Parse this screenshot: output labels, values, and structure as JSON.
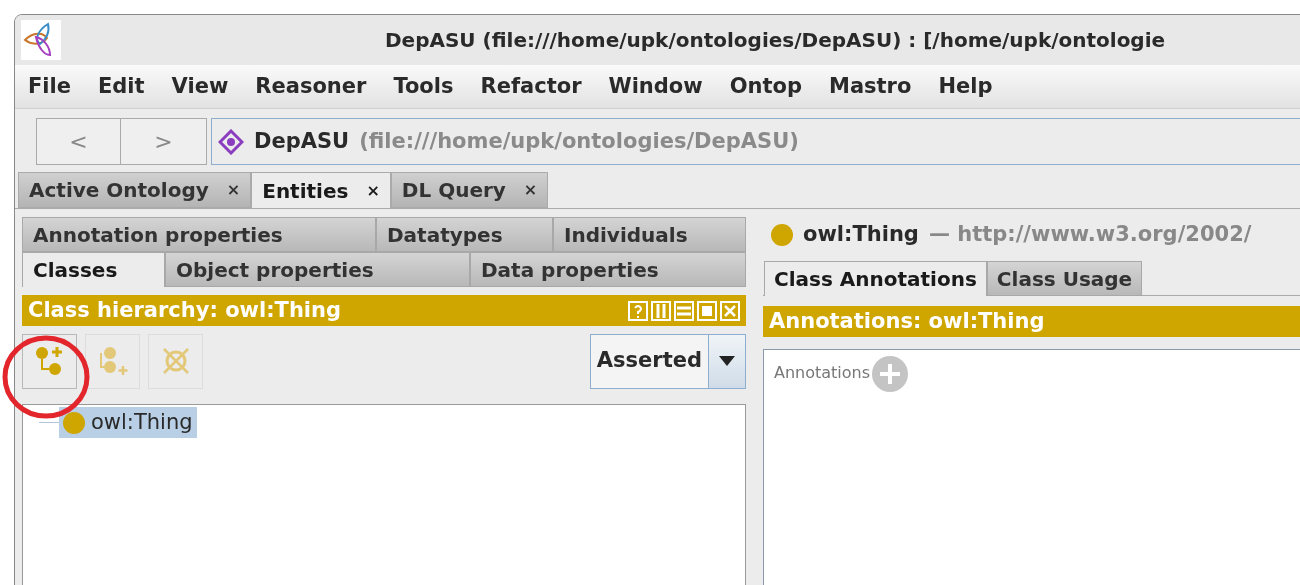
{
  "window": {
    "title": "DepASU (file:///home/upk/ontologies/DepASU) : [/home/upk/ontologie"
  },
  "menu": [
    "File",
    "Edit",
    "View",
    "Reasoner",
    "Tools",
    "Refactor",
    "Window",
    "Ontop",
    "Mastro",
    "Help"
  ],
  "nav": {
    "back": "<",
    "forward": ">",
    "ontology_name": "DepASU",
    "ontology_iri": "(file:///home/upk/ontologies/DepASU)"
  },
  "tabs": [
    {
      "label": "Active Ontology",
      "close": "×",
      "selected": false
    },
    {
      "label": "Entities",
      "close": "×",
      "selected": true
    },
    {
      "label": "DL Query",
      "close": "×",
      "selected": false
    }
  ],
  "left": {
    "entity_tab_rows": [
      [
        {
          "label": "Annotation properties",
          "selected": false
        },
        {
          "label": "Datatypes",
          "selected": false
        },
        {
          "label": "Individuals",
          "selected": false
        }
      ],
      [
        {
          "label": "Classes",
          "selected": true
        },
        {
          "label": "Object properties",
          "selected": false
        },
        {
          "label": "Data properties",
          "selected": false
        }
      ]
    ],
    "view_title": "Class hierarchy: owl:Thing",
    "toolbar": [
      {
        "kind": "add-subclass",
        "disabled": false
      },
      {
        "kind": "add-sibling",
        "disabled": true
      },
      {
        "kind": "delete",
        "disabled": true
      }
    ],
    "mode": "Asserted",
    "tree": [
      {
        "label": "owl:Thing",
        "selected": true
      }
    ]
  },
  "right": {
    "entity": "owl:Thing",
    "separator": "—",
    "iri": "http://www.w3.org/2002/",
    "tabs": [
      {
        "label": "Class Annotations",
        "selected": true
      },
      {
        "label": "Class Usage",
        "selected": false
      }
    ],
    "view_title": "Annotations: owl:Thing",
    "annotations_label": "Annotations"
  },
  "highlight": {
    "kind": "ellipse",
    "color": "#e3262b"
  }
}
